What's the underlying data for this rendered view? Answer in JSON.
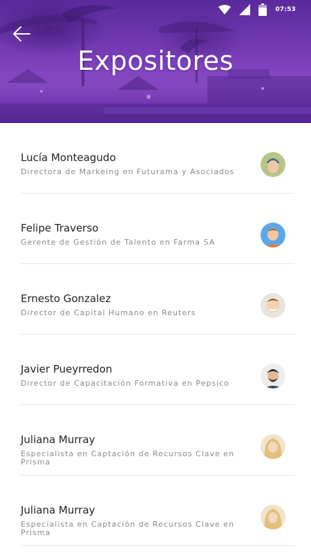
{
  "status_bar": {
    "time": "07:53",
    "icons": [
      "wifi-icon",
      "signal-icon",
      "battery-icon"
    ]
  },
  "header": {
    "back_icon": "arrow-left-icon",
    "title": "Expositores",
    "colors": {
      "primary": "#7a3fb8",
      "dark": "#5a2a9a"
    }
  },
  "speakers": [
    {
      "name": "Lucía Monteagudo",
      "role": "Directora de Markeing en Futurama y Asociados",
      "avatar": "avatar-woman-beanie"
    },
    {
      "name": "Felipe Traverso",
      "role": "Gerente de Gestión de Talento en Farma SA",
      "avatar": "avatar-man-blue"
    },
    {
      "name": "Ernesto Gonzalez",
      "role": "Director de Capital Humano en Reuters",
      "avatar": "avatar-man-smiling"
    },
    {
      "name": "Javier Pueyrredon",
      "role": "Director de Capacitación Formativa en Pepsico",
      "avatar": "avatar-man-dark"
    },
    {
      "name": "Juliana Murray",
      "role": "Especialista en Captación de Recursos Clave en Prisma",
      "avatar": "avatar-woman-blonde"
    },
    {
      "name": "Juliana Murray",
      "role": "Especialista en Captación de Recursos Clave en Prisma",
      "avatar": "avatar-woman-blonde"
    }
  ]
}
